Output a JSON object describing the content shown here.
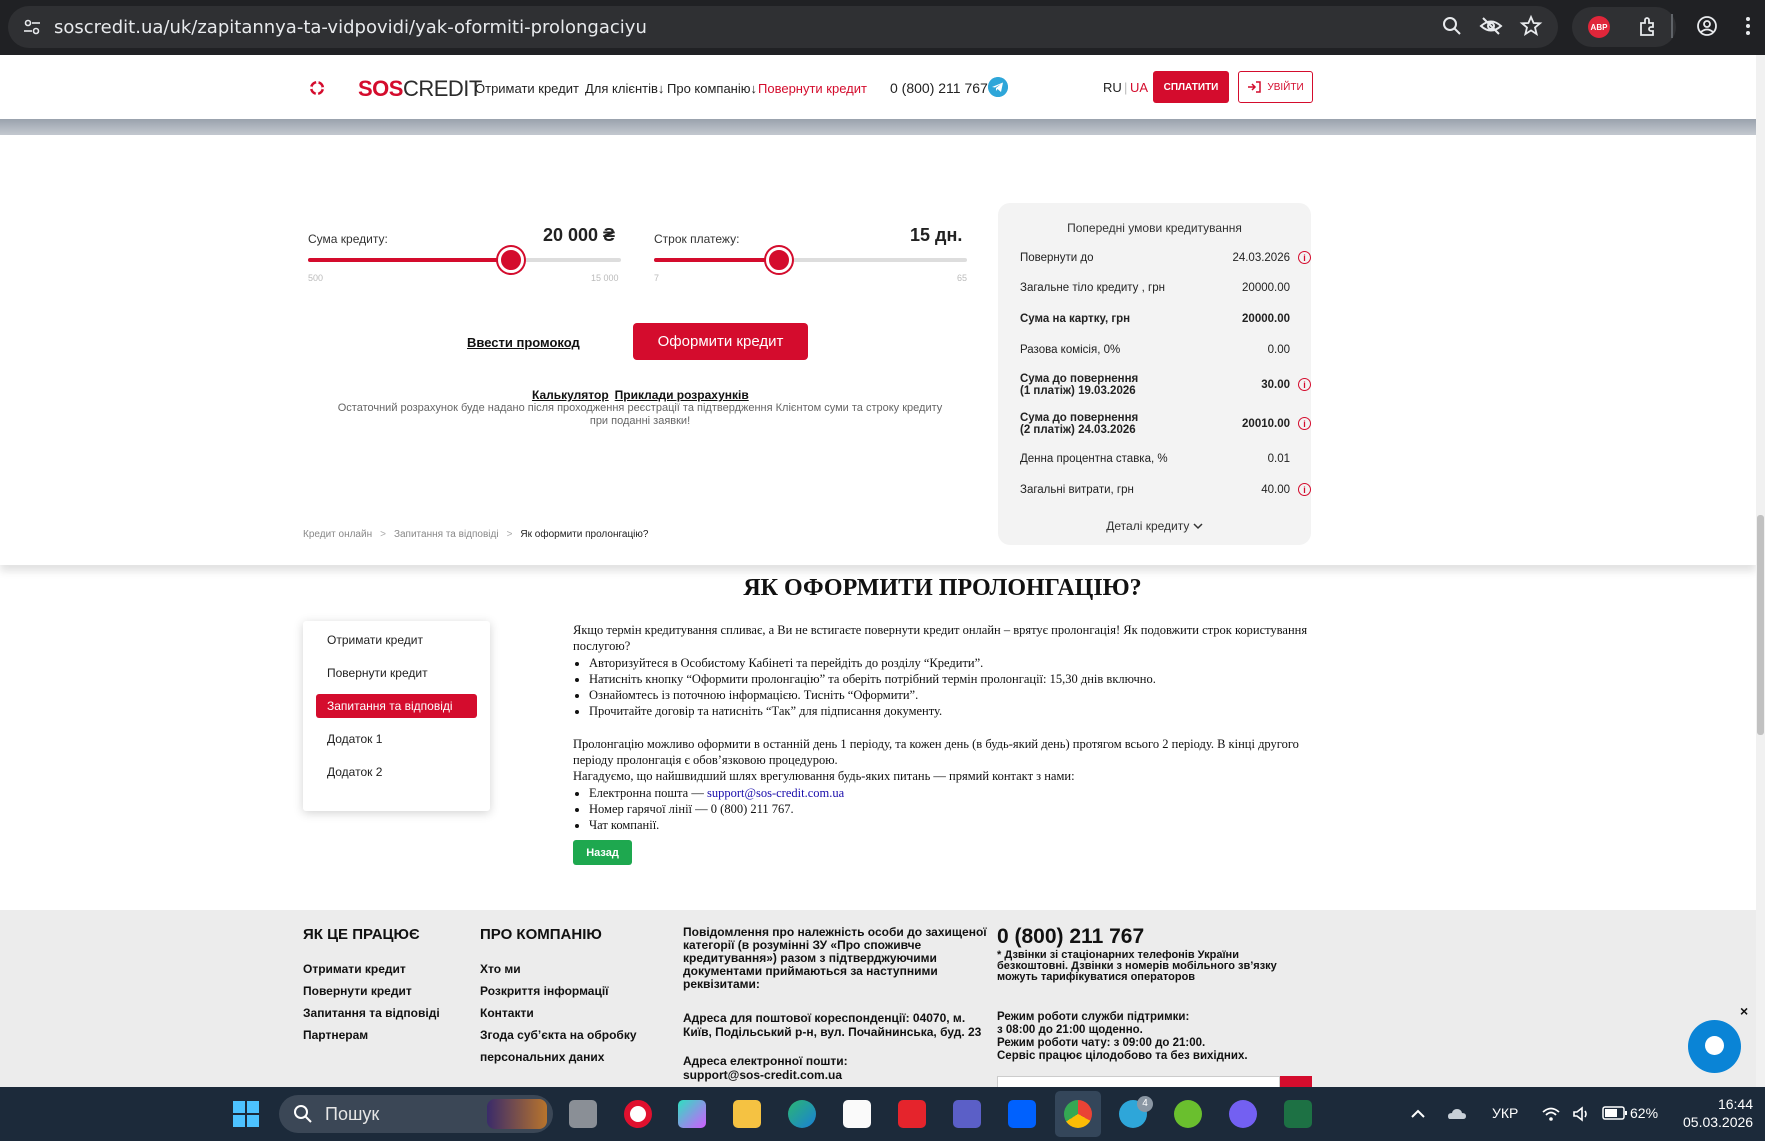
{
  "browser": {
    "url": "soscredit.ua/uk/zapitannya-ta-vidpovidi/yak-oformiti-prolongaciyu",
    "ext_badge": "ABP"
  },
  "header": {
    "logo_sos": "SOS",
    "logo_credit": "CREDIT",
    "nav": [
      "Отримати кредит",
      "Для клієнтів↓",
      "Про компанію↓",
      "Повернути кредит"
    ],
    "phone": "0 (800) 211 767",
    "lang_ru": "RU",
    "lang_sep": "|",
    "lang_ua": "UA",
    "pay_label": "СПЛАТИТИ",
    "login_label": "УВІЙТИ"
  },
  "calculator": {
    "amount_label": "Сума кредиту:",
    "amount_value": "20 000 ₴",
    "amount_min": "500",
    "amount_max": "15 000",
    "amount_fraction": 0.65,
    "term_label": "Строк платежу:",
    "term_value": "15 дн.",
    "term_min": "7",
    "term_max": "65",
    "term_fraction": 0.4,
    "promo_label": "Ввести промокод",
    "order_label": "Оформити кредит",
    "link_calc": "Калькулятор",
    "link_examples": "Приклади розрахунків",
    "note": "Остаточний розрахунок буде надано після проходження реєстрації та підтвердження Клієнтом суми та строку кредиту при поданні заявки!"
  },
  "conditions": {
    "title": "Попередні умови кредитування",
    "rows": [
      {
        "label": "Повернути до",
        "value": "24.03.2026",
        "info": true
      },
      {
        "label": "Загальне тіло кредиту , грн",
        "value": "20000.00",
        "info": false
      },
      {
        "label": "Сума на картку, грн",
        "value": "20000.00",
        "info": false
      },
      {
        "label": "Разова комісія, 0%",
        "value": "0.00",
        "info": false
      },
      {
        "label": "Сума до повернення\n(1 платіж) 19.03.2026",
        "value": "30.00",
        "info": true
      },
      {
        "label": "Сума до повернення\n(2 платіж) 24.03.2026",
        "value": "20010.00",
        "info": true
      },
      {
        "label": "Денна процентна ставка, %",
        "value": "0.01",
        "info": false
      },
      {
        "label": "Загальні витрати, грн",
        "value": "40.00",
        "info": true
      }
    ],
    "details_label": "Деталі кредиту",
    "info_glyph": "i"
  },
  "breadcrumb": [
    "Кредит онлайн",
    "Запитання та відповіді",
    "Як оформити пролонгацію?"
  ],
  "breadcrumb_sep": ">",
  "page_title": "ЯК ОФОРМИТИ ПРОЛОНГАЦІЮ?",
  "side_menu": [
    "Отримати кредит",
    "Повернути кредит",
    "Запитання та відповіді",
    "Додаток 1",
    "Додаток 2"
  ],
  "article": {
    "intro": "Якщо термін кредитування спливає, а Ви не встигаєте повернути кредит онлайн – врятує пролонгація! Як подовжити строк користування послугою?",
    "steps": [
      "Авторизуйтеся в Особистому Кабінеті та перейдіть до розділу “Кредити”.",
      "Натисніть кнопку “Оформити пролонгацію” та оберіть потрібний термін пролонгації: 15,30 днів включно.",
      "Ознайомтесь із поточною інформацією. Тисніть “Оформити”.",
      "Прочитайте договір та натисніть “Так” для підписання документу."
    ],
    "para2": "Пролонгацію можливо оформити в останній день 1 періоду, та кожен день (в будь-який день) протягом всього 2 періоду. В кінці другого періоду пролонгація є обов’язковою процедурою.",
    "para3": "Нагадуємо, що найшвидший шлях врегулювання будь-яких питань — прямий контакт з нами:",
    "contact_email_label": "Електронна пошта — ",
    "contact_email": "support@sos-credit.com.ua",
    "contact_phone": "Номер гарячої лінії —  0 (800) 211 767.",
    "contact_chat": "Чат компанії.",
    "back_label": "Назад"
  },
  "footer": {
    "col1_head": "ЯК ЦЕ ПРАЦЮЄ",
    "col1_links": [
      "Отримати кредит",
      "Повернути кредит",
      "Запитання та відповіді",
      "Партнерам"
    ],
    "col2_head": "ПРО КОМПАНІЮ",
    "col2_links": [
      "Хто ми",
      "Розкриття інформації",
      "Контакти",
      "Згода суб’єкта на обробку",
      "персональних даних"
    ],
    "notice": "Повідомлення про належність особи до захищеної категорії (в розумінні ЗУ «Про споживче кредитування») разом з підтверджуючими документами приймаються за наступними реквізитами:",
    "address": "Адреса для поштової кореспонденції: 04070, м. Київ, Подільський р-н, вул. Почайнинська, буд. 23",
    "email": "Адреса електронної пошти: support@sos-credit.com.ua",
    "phone": "0 (800) 211 767",
    "phone_note": "* Дзвінки зі стаціонарних телефонів України безкоштовні. Дзвінки з номерів мобільного зв’язку можуть тарифікуватися операторов",
    "hours": "Режим роботи служби підтримки:\nз 08:00 до 21:00 щоденно.\nРежим роботи чату: з 09:00 до 21:00.\nСервіс працює цілодобово та без вихідних.",
    "chat_close": "×"
  },
  "taskbar": {
    "search_label": "Пошук",
    "telegram_badge": "4",
    "lang": "УКР",
    "battery": "62%",
    "time": "16:44",
    "date": "05.03.2026"
  },
  "colors": {
    "brand_red": "#d40c2d",
    "green_button": "#1ea84f",
    "chat_blue": "#0a84d6"
  }
}
